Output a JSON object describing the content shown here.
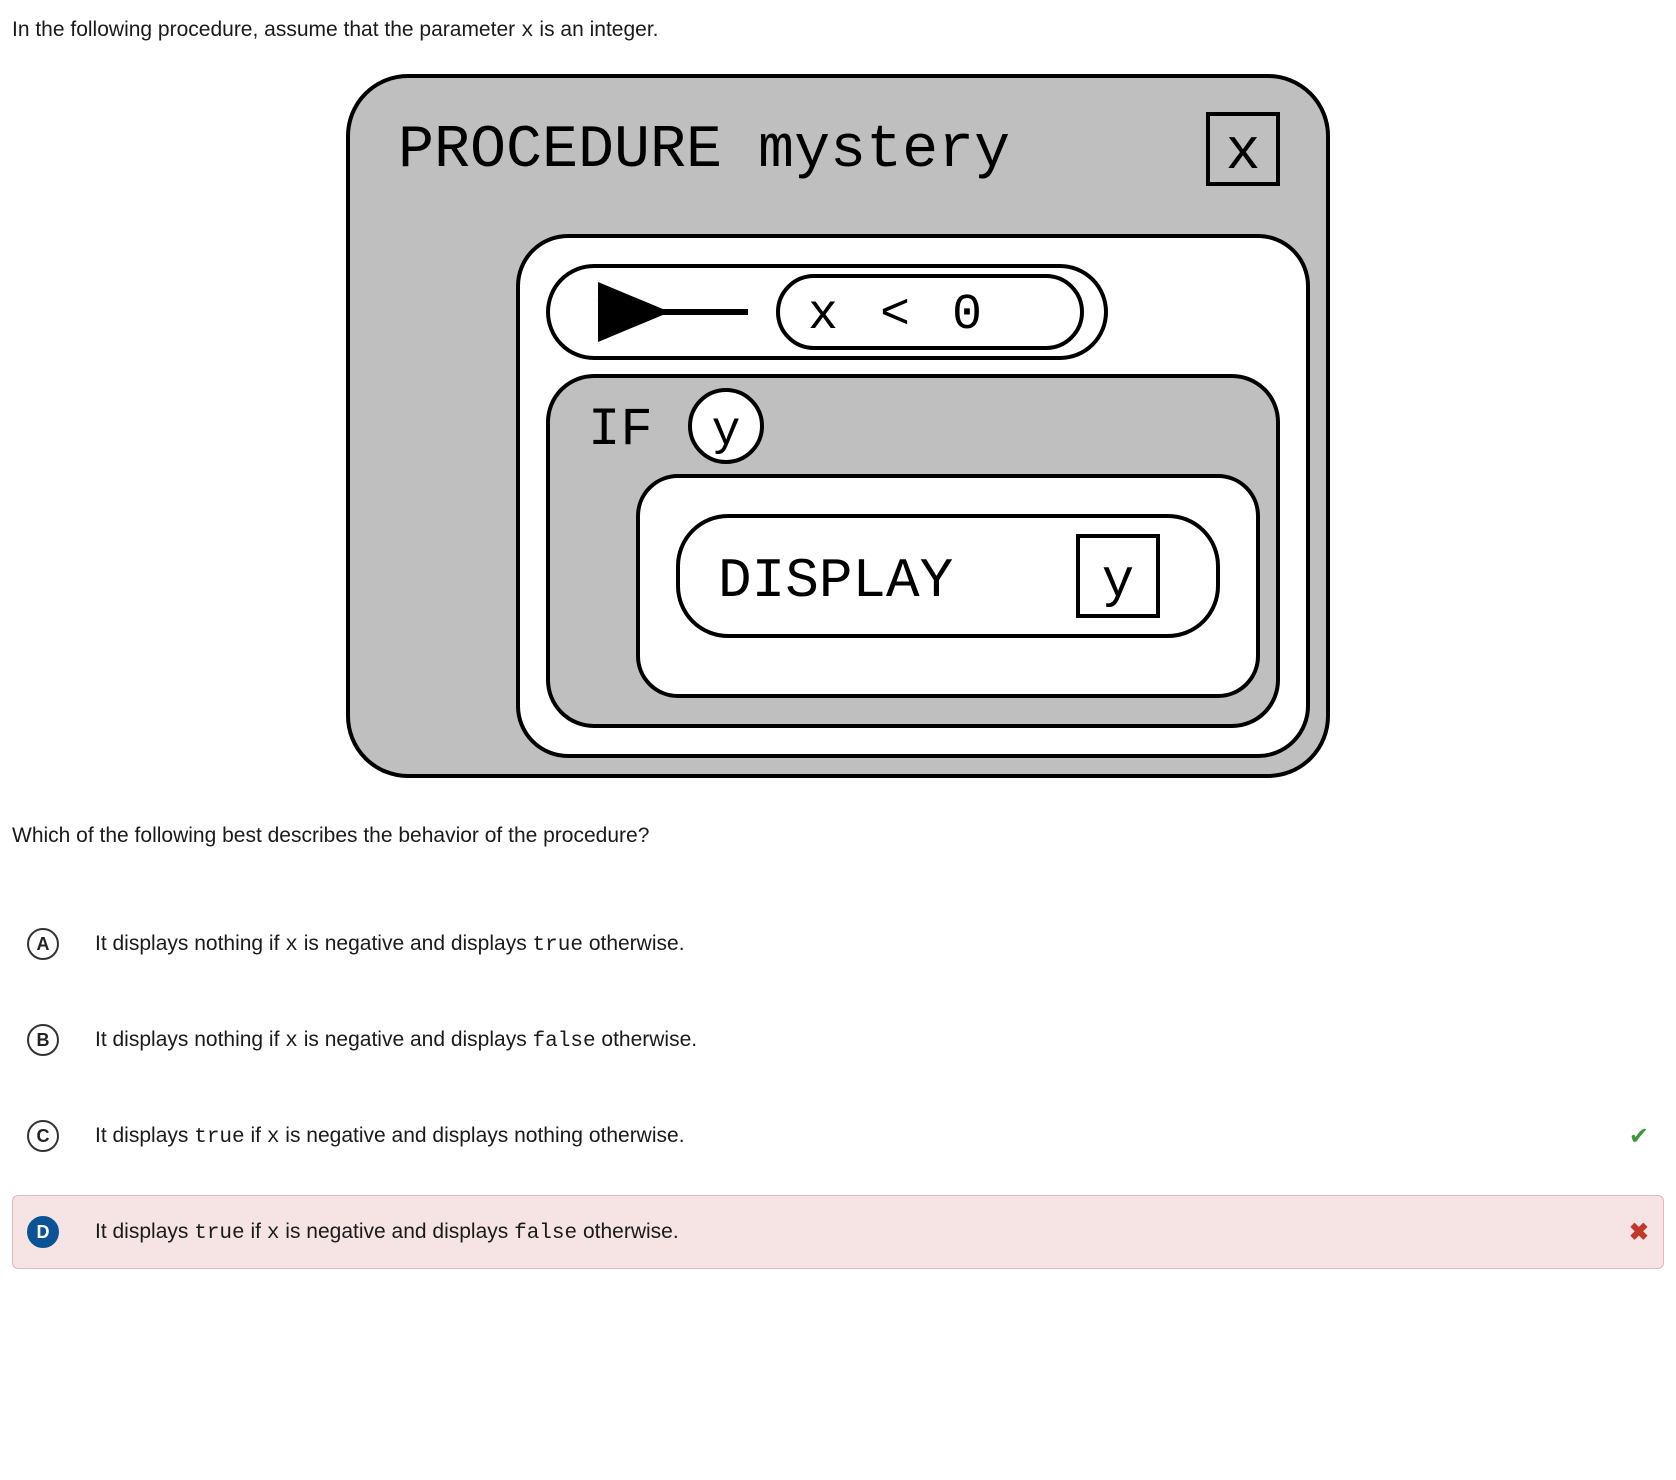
{
  "intro": {
    "pre": "In the following procedure, assume that the parameter ",
    "code": "x",
    "post": " is an integer."
  },
  "diagram": {
    "procedure_label": "PROCEDURE mystery",
    "procedure_param": "x",
    "assign_var": "y",
    "assign_expr": "x < 0",
    "if_label": "IF",
    "if_cond": "y",
    "display_label": "DISPLAY",
    "display_arg": "y"
  },
  "prompt": "Which of the following best describes the behavior of the procedure?",
  "answers": {
    "a": {
      "letter": "A",
      "parts": [
        "It displays nothing if ",
        "x",
        " is negative and displays ",
        "true",
        " otherwise."
      ]
    },
    "b": {
      "letter": "B",
      "parts": [
        "It displays nothing if ",
        "x",
        " is negative and displays ",
        "false",
        " otherwise."
      ]
    },
    "c": {
      "letter": "C",
      "parts": [
        "It displays ",
        "true",
        " if ",
        "x",
        " is negative and displays nothing otherwise."
      ]
    },
    "d": {
      "letter": "D",
      "parts": [
        "It displays ",
        "true",
        " if ",
        "x",
        " is negative and displays ",
        "false",
        " otherwise."
      ]
    }
  },
  "icons": {
    "check": "✔",
    "cross": "✖"
  }
}
